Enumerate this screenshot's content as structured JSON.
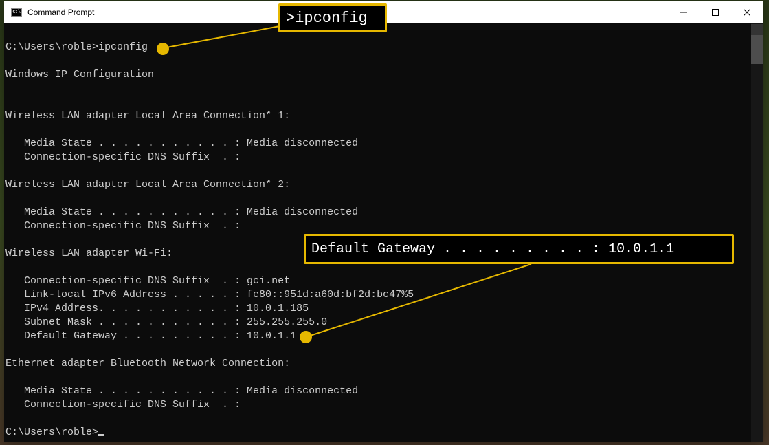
{
  "window": {
    "title": "Command Prompt",
    "icon_label": "C:\\"
  },
  "terminal": {
    "prompt1": "C:\\Users\\roble>",
    "command": "ipconfig",
    "lines": [
      "",
      "Windows IP Configuration",
      "",
      "",
      "Wireless LAN adapter Local Area Connection* 1:",
      "",
      "   Media State . . . . . . . . . . . : Media disconnected",
      "   Connection-specific DNS Suffix  . :",
      "",
      "Wireless LAN adapter Local Area Connection* 2:",
      "",
      "   Media State . . . . . . . . . . . : Media disconnected",
      "   Connection-specific DNS Suffix  . :",
      "",
      "Wireless LAN adapter Wi-Fi:",
      "",
      "   Connection-specific DNS Suffix  . : gci.net",
      "   Link-local IPv6 Address . . . . . : fe80::951d:a60d:bf2d:bc47%5",
      "   IPv4 Address. . . . . . . . . . . : 10.0.1.185",
      "   Subnet Mask . . . . . . . . . . . : 255.255.255.0",
      "   Default Gateway . . . . . . . . . : 10.0.1.1",
      "",
      "Ethernet adapter Bluetooth Network Connection:",
      "",
      "   Media State . . . . . . . . . . . : Media disconnected",
      "   Connection-specific DNS Suffix  . :",
      ""
    ],
    "prompt2": "C:\\Users\\roble>"
  },
  "callouts": {
    "ipconfig": ">ipconfig",
    "gateway": "Default Gateway . . . . . . . . . : 10.0.1.1"
  }
}
